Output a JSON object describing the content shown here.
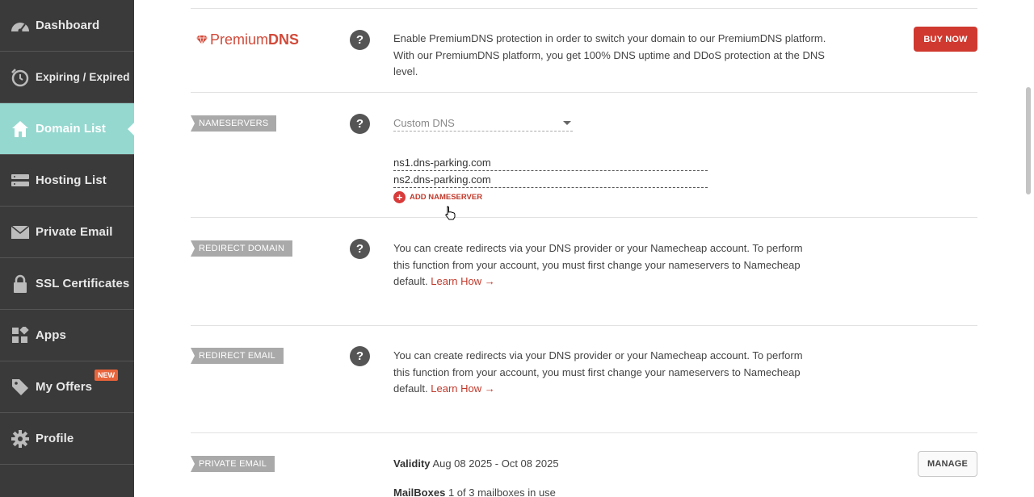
{
  "sidebar": {
    "items": [
      {
        "label": "Dashboard",
        "icon": "speedometer-icon"
      },
      {
        "label": "Expiring / Expired",
        "icon": "clock-icon"
      },
      {
        "label": "Domain List",
        "icon": "home-icon",
        "active": true
      },
      {
        "label": "Hosting List",
        "icon": "server-icon"
      },
      {
        "label": "Private Email",
        "icon": "envelope-icon"
      },
      {
        "label": "SSL Certificates",
        "icon": "lock-icon"
      },
      {
        "label": "Apps",
        "icon": "apps-grid-icon"
      },
      {
        "label": "My Offers",
        "icon": "tag-icon",
        "badge": "NEW"
      },
      {
        "label": "Profile",
        "icon": "gear-icon"
      }
    ]
  },
  "premium_dns": {
    "logo_prefix": "Premium",
    "logo_suffix": "DNS",
    "help": "?",
    "description": "Enable PremiumDNS protection in order to switch your domain to our PremiumDNS platform. With our PremiumDNS platform, you get 100% DNS uptime and DDoS protection at the DNS level.",
    "buy_label": "BUY NOW"
  },
  "nameservers": {
    "tag": "NAMESERVERS",
    "help": "?",
    "select_value": "Custom DNS",
    "entries": [
      "ns1.dns-parking.com",
      "ns2.dns-parking.com"
    ],
    "add_label": "ADD NAMESERVER"
  },
  "redirect_domain": {
    "tag": "REDIRECT DOMAIN",
    "help": "?",
    "description": "You can create redirects via your DNS provider or your Namecheap account. To perform this function from your account, you must first change your nameservers to Namecheap default.",
    "link": "Learn How →"
  },
  "redirect_email": {
    "tag": "REDIRECT EMAIL",
    "help": "?",
    "description": "You can create redirects via your DNS provider or your Namecheap account. To perform this function from your account, you must first change your nameservers to Namecheap default.",
    "link": "Learn How →"
  },
  "private_email": {
    "tag": "PRIVATE EMAIL",
    "validity_label": "Validity",
    "validity_value": "Aug 08 2025 - Oct 08 2025",
    "mailboxes_label": "MailBoxes",
    "mailboxes_value": "1 of 3 mailboxes in use",
    "manage_label": "MANAGE"
  },
  "colors": {
    "sidebar_bg": "#3a3a3a",
    "active_bg": "#95d8cf",
    "accent_red": "#d0392f"
  }
}
